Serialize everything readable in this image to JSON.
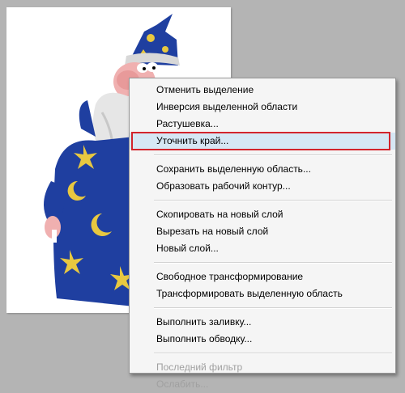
{
  "menu": {
    "groups": [
      [
        {
          "label": "Отменить выделение",
          "enabled": true
        },
        {
          "label": "Инверсия выделенной области",
          "enabled": true
        },
        {
          "label": "Растушевка...",
          "enabled": true
        },
        {
          "label": "Уточнить край...",
          "enabled": true,
          "highlighted": true
        }
      ],
      [
        {
          "label": "Сохранить выделенную область...",
          "enabled": true
        },
        {
          "label": "Образовать рабочий контур...",
          "enabled": true
        }
      ],
      [
        {
          "label": "Скопировать на новый слой",
          "enabled": true
        },
        {
          "label": "Вырезать на новый слой",
          "enabled": true
        },
        {
          "label": "Новый слой...",
          "enabled": true
        }
      ],
      [
        {
          "label": "Свободное трансформирование",
          "enabled": true
        },
        {
          "label": "Трансформировать выделенную область",
          "enabled": true
        }
      ],
      [
        {
          "label": "Выполнить заливку...",
          "enabled": true
        },
        {
          "label": "Выполнить обводку...",
          "enabled": true
        }
      ],
      [
        {
          "label": "Последний фильтр",
          "enabled": false
        },
        {
          "label": "Ослабить...",
          "enabled": false
        }
      ]
    ]
  },
  "colors": {
    "background": "#b4b4b4",
    "robe": "#1f3fa0",
    "stars": "#e8c840",
    "highlight_border": "#d3242c",
    "highlight_fill": "#d6e7f4"
  }
}
